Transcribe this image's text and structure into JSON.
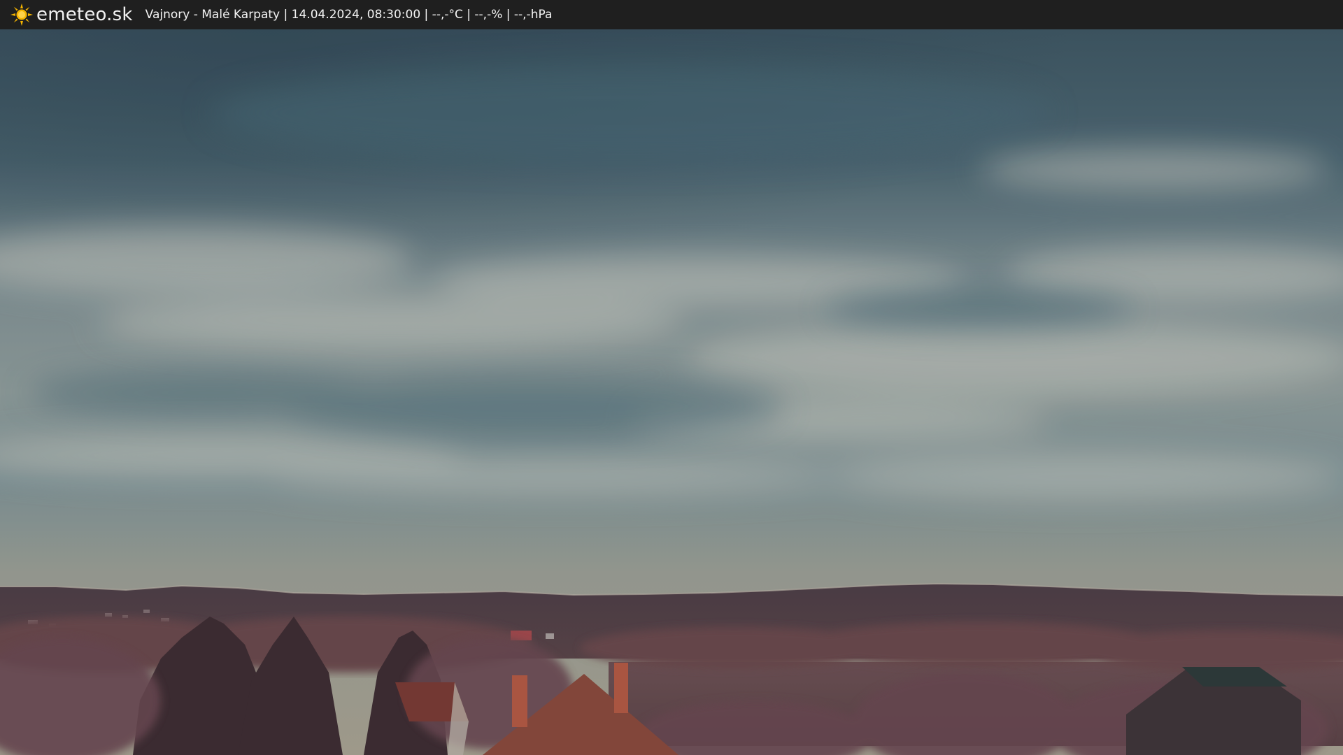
{
  "header": {
    "brand": "emeteo.sk",
    "logo_icon": "sun-icon",
    "caption": "Vajnory - Malé Karpaty | 14.04.2024, 08:30:00 | --,-°C | --,-% | --,-hPa"
  },
  "colors": {
    "bar_background": "#1f1f1f",
    "sun_yellow": "#f5b400"
  }
}
